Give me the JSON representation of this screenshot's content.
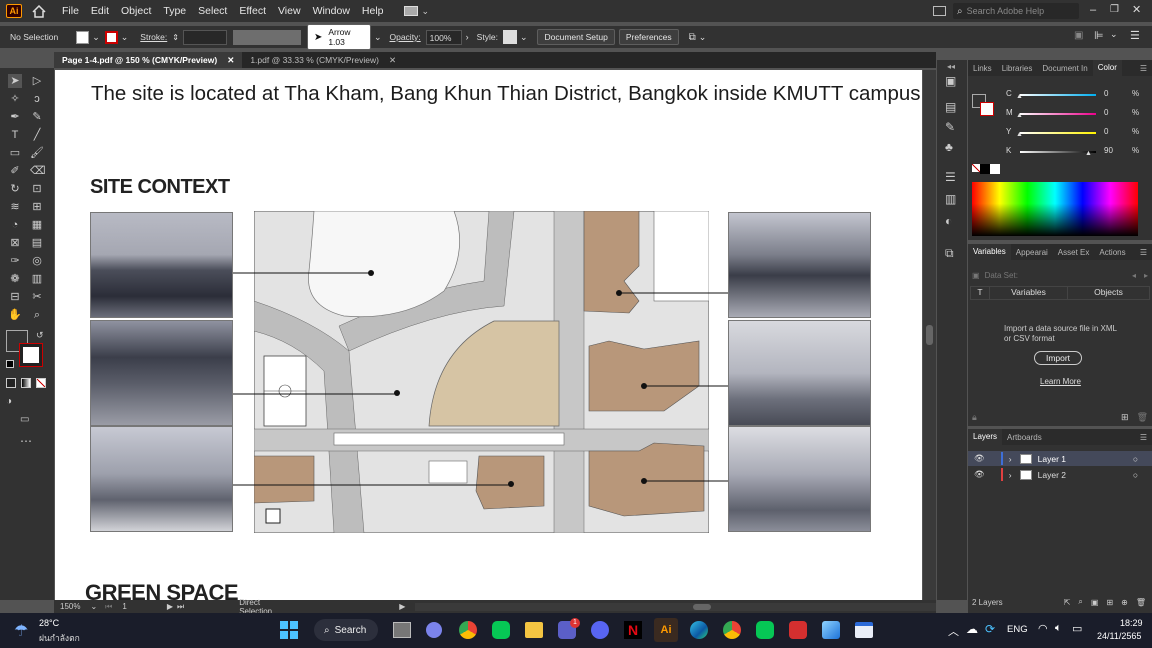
{
  "app": {
    "logo": "Ai",
    "menus": [
      "File",
      "Edit",
      "Object",
      "Type",
      "Select",
      "Effect",
      "View",
      "Window",
      "Help"
    ],
    "search_placeholder": "Search Adobe Help"
  },
  "control_bar": {
    "selection": "No Selection",
    "stroke_label": "Stroke:",
    "brush": "Arrow 1.03",
    "opacity_label": "Opacity:",
    "opacity_value": "100%",
    "style_label": "Style:",
    "doc_setup": "Document Setup",
    "preferences": "Preferences"
  },
  "tabs": [
    {
      "label": "Page 1-4.pdf @ 150 % (CMYK/Preview)",
      "active": true
    },
    {
      "label": "1.pdf @ 33.33 % (CMYK/Preview)",
      "active": false
    }
  ],
  "document": {
    "intro": "The site is located at Tha Kham, Bang Khun Thian District, Bangkok inside KMUTT campus.",
    "heading1": "SITE CONTEXT",
    "heading2": "GREEN SPACE"
  },
  "color_panel": {
    "tabs": [
      "Links",
      "Libraries",
      "Document In",
      "Color"
    ],
    "channels": [
      {
        "name": "C",
        "value": "0"
      },
      {
        "name": "M",
        "value": "0"
      },
      {
        "name": "Y",
        "value": "0"
      },
      {
        "name": "K",
        "value": "90"
      }
    ],
    "unit": "%"
  },
  "variables_panel": {
    "tabs": [
      "Variables",
      "Appearai",
      "Asset Ex",
      "Actions"
    ],
    "dataset_label": "Data Set:",
    "col_variables": "Variables",
    "col_objects": "Objects",
    "message": "Import a data source file in XML or CSV format",
    "import_button": "Import",
    "learn_more": "Learn More"
  },
  "layers_panel": {
    "tabs": [
      "Layers",
      "Artboards"
    ],
    "layers": [
      {
        "name": "Layer 1",
        "color": "#3e6fd8"
      },
      {
        "name": "Layer 2",
        "color": "#e04040"
      }
    ],
    "count": "2 Layers"
  },
  "status": {
    "zoom": "150%",
    "page": "1",
    "tool": "Direct Selection"
  },
  "taskbar": {
    "weather_temp": "28°C",
    "weather_desc": "ฝนกำลังตก",
    "search": "Search",
    "lang": "ENG",
    "time": "18:29",
    "date": "24/11/2565",
    "badge": "1"
  }
}
